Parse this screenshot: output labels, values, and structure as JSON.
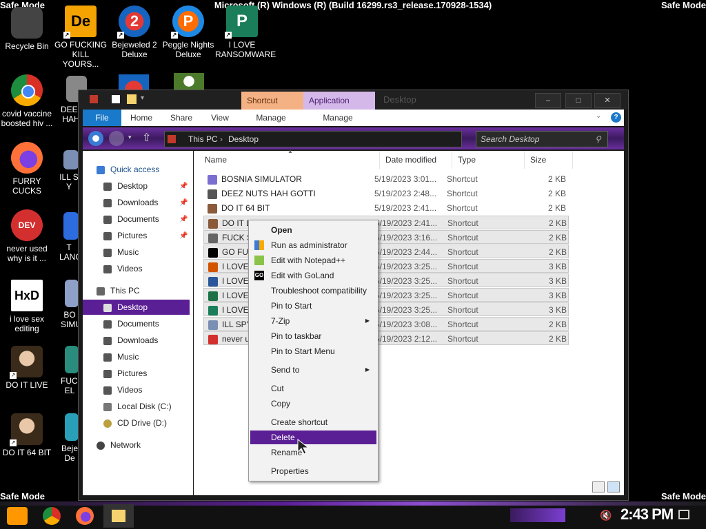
{
  "watermark": {
    "safe_mode": "Safe Mode",
    "build": "Microsoft (R) Windows (R) (Build 16299.rs3_release.170928-1534)"
  },
  "desktop_icons": [
    {
      "label": "Recycle Bin",
      "icon": "recycle-bin-icon"
    },
    {
      "label": "GO FUCKING KILL YOURS...",
      "icon": "de-app-icon"
    },
    {
      "label": "Bejeweled 2 Deluxe",
      "icon": "bejeweled-icon"
    },
    {
      "label": "Peggle Nights Deluxe",
      "icon": "peggle-icon"
    },
    {
      "label": "I LOVE RANSOMWARE",
      "icon": "publisher-icon"
    },
    {
      "label": "covid vaccine boosted hiv ...",
      "icon": "chrome-icon"
    },
    {
      "label": "DEEZ HAH",
      "icon": "shortcut-icon"
    },
    {
      "label": "FURRY CUCKS",
      "icon": "firefox-icon"
    },
    {
      "label": "ILL S Y",
      "icon": "shortcut-icon"
    },
    {
      "label": "never used why is it ...",
      "icon": "devcpp-icon"
    },
    {
      "label": "T LANGU",
      "icon": "shortcut-icon"
    },
    {
      "label": "i love sex editing",
      "icon": "hxd-icon"
    },
    {
      "label": "BO SIMU",
      "icon": "shortcut-icon"
    },
    {
      "label": "DO IT LIVE",
      "icon": "portrait-icon"
    },
    {
      "label": "FUCK EL",
      "icon": "shortcut-icon"
    },
    {
      "label": "DO IT 64 BIT",
      "icon": "portrait-icon"
    },
    {
      "label": "Beje De",
      "icon": "bejeweled-icon"
    }
  ],
  "window": {
    "title": "Desktop",
    "ctx_shortcut": "Shortcut Tools",
    "ctx_application": "Application Tools",
    "ribbon": {
      "file": "File",
      "home": "Home",
      "share": "Share",
      "view": "View",
      "manage1": "Manage",
      "manage2": "Manage"
    },
    "breadcrumb": {
      "this_pc": "This PC",
      "desktop": "Desktop"
    },
    "search_placeholder": "Search Desktop",
    "controls": {
      "minimize": "–",
      "maximize": "□",
      "close": "✕"
    }
  },
  "nav": [
    {
      "label": "Quick access",
      "icon": "star-icon"
    },
    {
      "label": "Desktop",
      "icon": "folder-icon"
    },
    {
      "label": "Downloads",
      "icon": "folder-icon"
    },
    {
      "label": "Documents",
      "icon": "folder-icon"
    },
    {
      "label": "Pictures",
      "icon": "folder-icon"
    },
    {
      "label": "Music",
      "icon": "folder-icon"
    },
    {
      "label": "Videos",
      "icon": "folder-icon"
    },
    {
      "label": "This PC",
      "icon": "computer-icon"
    },
    {
      "label": "Desktop",
      "icon": "folder-icon"
    },
    {
      "label": "Documents",
      "icon": "folder-icon"
    },
    {
      "label": "Downloads",
      "icon": "folder-icon"
    },
    {
      "label": "Music",
      "icon": "folder-icon"
    },
    {
      "label": "Pictures",
      "icon": "folder-icon"
    },
    {
      "label": "Videos",
      "icon": "folder-icon"
    },
    {
      "label": "Local Disk (C:)",
      "icon": "disk-icon"
    },
    {
      "label": "CD Drive (D:)",
      "icon": "cd-icon"
    },
    {
      "label": "Network",
      "icon": "network-icon"
    }
  ],
  "columns": {
    "name": "Name",
    "date": "Date modified",
    "type": "Type",
    "size": "Size"
  },
  "files": [
    {
      "name": "BOSNIA SIMULATOR",
      "date": "5/19/2023 3:01...",
      "type": "Shortcut",
      "size": "2 KB"
    },
    {
      "name": "DEEZ NUTS HAH GOTTI",
      "date": "5/19/2023 2:48...",
      "type": "Shortcut",
      "size": "2 KB"
    },
    {
      "name": "DO IT 64 BIT",
      "date": "5/19/2023 2:41...",
      "type": "Shortcut",
      "size": "2 KB"
    },
    {
      "name": "DO IT LIVE",
      "date": "5/19/2023 2:41...",
      "type": "Shortcut",
      "size": "2 KB"
    },
    {
      "name": "FUCK SOI",
      "date": "5/19/2023 3:16...",
      "type": "Shortcut",
      "size": "2 KB"
    },
    {
      "name": "GO FUCK",
      "date": "5/19/2023 2:44...",
      "type": "Shortcut",
      "size": "2 KB"
    },
    {
      "name": "I LOVE EI",
      "date": "5/19/2023 3:25...",
      "type": "Shortcut",
      "size": "3 KB"
    },
    {
      "name": "I LOVE M",
      "date": "5/19/2023 3:25...",
      "type": "Shortcut",
      "size": "3 KB"
    },
    {
      "name": "I LOVE M",
      "date": "5/19/2023 3:25...",
      "type": "Shortcut",
      "size": "3 KB"
    },
    {
      "name": "I LOVE RA",
      "date": "5/19/2023 3:25...",
      "type": "Shortcut",
      "size": "3 KB"
    },
    {
      "name": "ILL SPY C",
      "date": "5/19/2023 3:08...",
      "type": "Shortcut",
      "size": "2 KB"
    },
    {
      "name": "never us",
      "date": "5/19/2023 2:12...",
      "type": "Shortcut",
      "size": "2 KB"
    }
  ],
  "context_menu": {
    "open": "Open",
    "run_admin": "Run as administrator",
    "edit_notepad": "Edit with Notepad++",
    "edit_goland": "Edit with GoLand",
    "troubleshoot": "Troubleshoot compatibility",
    "pin_start": "Pin to Start",
    "zip": "7-Zip",
    "pin_taskbar": "Pin to taskbar",
    "pin_start_menu": "Pin to Start Menu",
    "send_to": "Send to",
    "cut": "Cut",
    "copy": "Copy",
    "create_shortcut": "Create shortcut",
    "delete": "Delete",
    "rename": "Rename",
    "properties": "Properties"
  },
  "taskbar": {
    "clock": "2:43 PM"
  }
}
